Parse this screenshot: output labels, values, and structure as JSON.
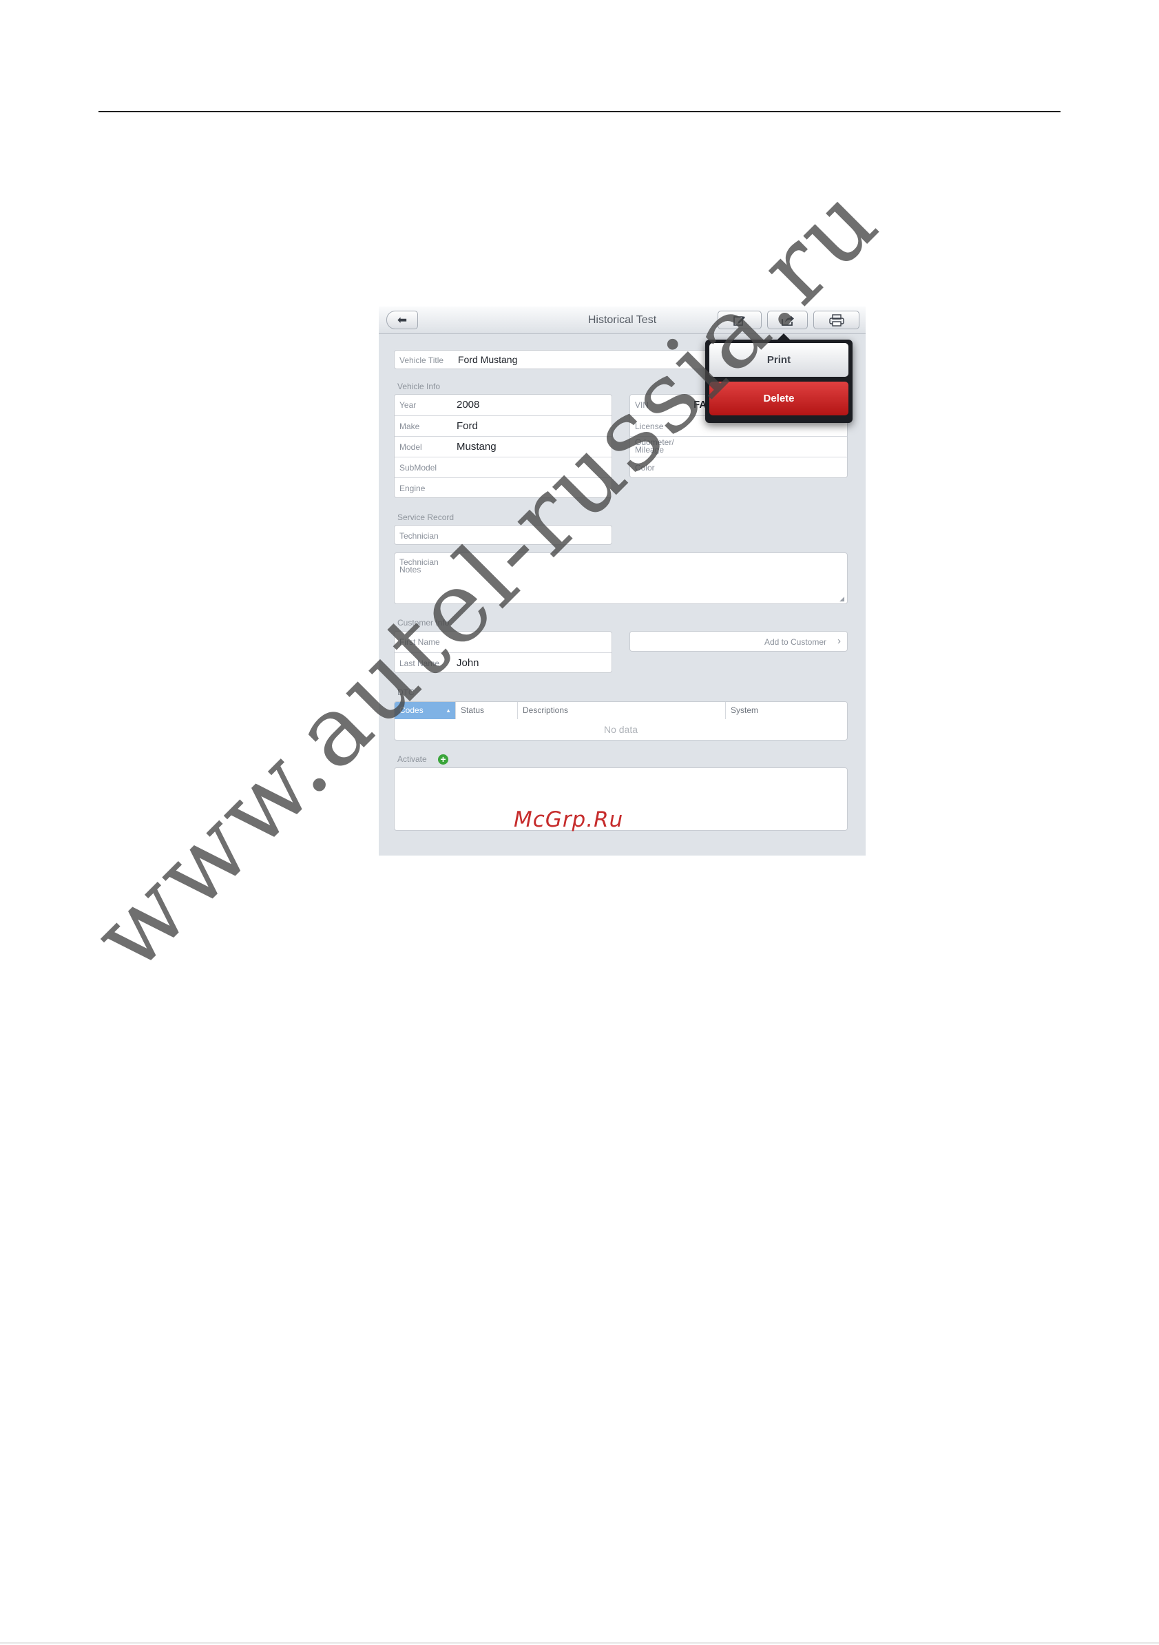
{
  "toolbar": {
    "title": "Historical Test"
  },
  "popover": {
    "print_label": "Print",
    "delete_label": "Delete"
  },
  "vehicle_title": {
    "label": "Vehicle Title",
    "value": "Ford Mustang"
  },
  "vehicle_info": {
    "heading": "Vehicle Info",
    "left": [
      {
        "label": "Year",
        "value": "2008"
      },
      {
        "label": "Make",
        "value": "Ford"
      },
      {
        "label": "Model",
        "value": "Mustang"
      },
      {
        "label": "SubModel",
        "value": ""
      },
      {
        "label": "Engine",
        "value": ""
      }
    ],
    "right": [
      {
        "label": "VIN",
        "value": "FA"
      },
      {
        "label": "License",
        "value": ""
      },
      {
        "label": "Odometer/\nMileage",
        "value": ""
      },
      {
        "label": "Color",
        "value": ""
      }
    ]
  },
  "service_record": {
    "heading": "Service Record",
    "technician_label": "Technician",
    "notes_label": "Technician\nNotes"
  },
  "customer_info": {
    "heading": "Customer Info",
    "first_name_label": "First Name",
    "first_name_value": "",
    "last_name_label": "Last Name",
    "last_name_value": "John",
    "add_label": "Add to Customer"
  },
  "dtc": {
    "heading": "DTC",
    "columns": [
      "Codes",
      "Status",
      "Descriptions",
      "System"
    ],
    "empty_text": "No data"
  },
  "activate": {
    "label": "Activate"
  },
  "overlay": {
    "mcgrp": "McGrp.Ru",
    "watermark": "www.autel-russia.ru"
  },
  "colors": {
    "delete_red": "#c62020",
    "codes_header_blue": "#7fb2e5",
    "add_green": "#3aa53a"
  }
}
